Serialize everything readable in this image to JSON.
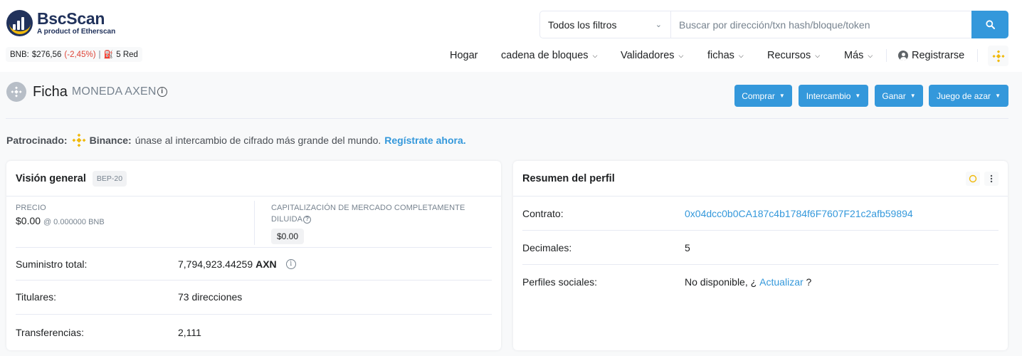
{
  "header": {
    "logo_name": "BscScan",
    "logo_sub": "A product of Etherscan",
    "bnb_label": "BNB:",
    "bnb_price": "$276,56",
    "bnb_change": "(-2,45%)",
    "separator": "|",
    "gas_text": "5 Red",
    "search": {
      "filter": "Todos los filtros",
      "placeholder": "Buscar por dirección/txn hash/bloque/token"
    },
    "nav": {
      "home": "Hogar",
      "blockchain": "cadena de bloques",
      "validators": "Validadores",
      "tokens": "fichas",
      "resources": "Recursos",
      "more": "Más",
      "register": "Registrarse"
    }
  },
  "page": {
    "title": "Ficha",
    "subtitle": "MONEDA AXEN",
    "buttons": {
      "buy": "Comprar",
      "exchange": "Intercambio",
      "earn": "Ganar",
      "gaming": "Juego de azar"
    }
  },
  "sponsor": {
    "label": "Patrocinado:",
    "brand": "Binance:",
    "text": "únase al intercambio de cifrado más grande del mundo.",
    "cta": "Regístrate ahora."
  },
  "overview": {
    "title": "Visión general",
    "badge": "BEP-20",
    "price_label": "PRECIO",
    "price_value": "$0.00",
    "price_bnb": "@ 0.000000 BNB",
    "mcap_label": "CAPITALIZACIÓN DE MERCADO COMPLETAMENTE DILUIDA",
    "mcap_value": "$0.00",
    "supply_label": "Suministro total:",
    "supply_value": "7,794,923.44259",
    "supply_symbol": "AXN",
    "holders_label": "Titulares:",
    "holders_value": "73 direcciones",
    "transfers_label": "Transferencias:",
    "transfers_value": "2,111"
  },
  "profile": {
    "title": "Resumen del perfil",
    "contract_label": "Contrato:",
    "contract_value": "0x04dcc0b0CA187c4b1784f6F7607F21c2afb59894",
    "decimals_label": "Decimales:",
    "decimals_value": "5",
    "social_label": "Perfiles sociales:",
    "social_prefix": "No disponible, ¿",
    "social_link": "Actualizar",
    "social_suffix": " ?"
  },
  "colors": {
    "primary": "#3498db",
    "negative": "#de4437",
    "brand": "#21325b",
    "bnb": "#f0b90b"
  }
}
